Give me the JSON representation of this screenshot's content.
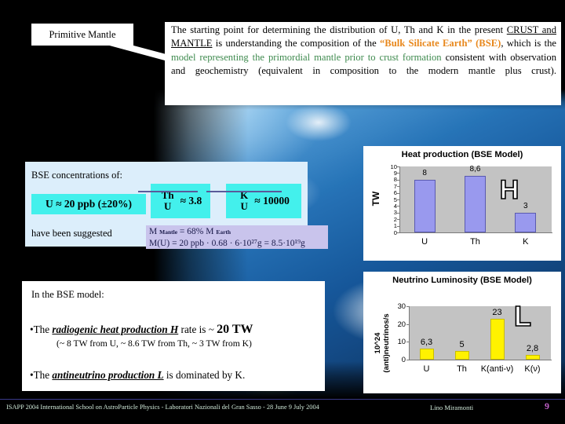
{
  "slide": {
    "background": "earth-from-space-photo",
    "page_number": "9"
  },
  "callout": {
    "label": "Primitive Mantle"
  },
  "top_box": {
    "seg1": "The starting point for determining the distribution of U, Th and K in the present ",
    "seg2_underlined": "CRUST and MANTLE",
    "seg3": " is understanding the composition of the ",
    "seg4_bse": "“Bulk Silicate Earth” (BSE)",
    "seg5": ", which is the ",
    "seg6_green": "model representing the primordial mantle prior to crust formation",
    "seg7": " consistent with observation and geochemistry (equivalent in composition to the modern mantle plus crust)."
  },
  "concentrations": {
    "title": "BSE concentrations of:",
    "u_value": "U ≈ 20 ppb (±20%)",
    "suggested": "have been suggested",
    "ratios": [
      {
        "num": "Th",
        "den": "U",
        "value": "≈ 3.8"
      },
      {
        "num": "K",
        "den": "U",
        "value": "≈ 10000"
      }
    ]
  },
  "mass_box": {
    "line1_pre": "M ",
    "line1_sub": "Mantle",
    "line1_post": " = 68% M ",
    "line1_sub2": "Earth",
    "line2": "M(U) = 20 ppb · 0.68 · 6·10²⁷g = 8.5·10¹⁹g"
  },
  "bottom_box": {
    "intro": "In the BSE model:",
    "bullet1_pre": "•The ",
    "bullet1_em": "radiogenic heat production H",
    "bullet1_mid": " rate is ~ ",
    "bullet1_big": "20 TW",
    "bullet1_sub": "(~ 8 TW from U, ~ 8.6 TW from Th, ~ 3 TW from K)",
    "bullet2_pre": "•The ",
    "bullet2_em": "antineutrino production L",
    "bullet2_post": " is dominated by K."
  },
  "charts": [
    {
      "id": "heat-production-chart",
      "overlay_letter": "H"
    },
    {
      "id": "neutrino-luminosity-chart",
      "overlay_letter": "L"
    }
  ],
  "chart_data": [
    {
      "type": "bar",
      "id": "heat-production-chart",
      "title": "Heat production (BSE Model)",
      "xlabel": "",
      "ylabel": "TW",
      "categories": [
        "U",
        "Th",
        "K"
      ],
      "values": [
        8,
        8.6,
        3
      ],
      "value_labels": [
        "8",
        "8,6",
        "3"
      ],
      "ylim": [
        0,
        10
      ],
      "yticks": [
        0,
        1,
        2,
        3,
        4,
        5,
        6,
        7,
        8,
        9,
        10
      ],
      "ytick_labels": [
        "0",
        "1",
        "2",
        "3",
        "4",
        "5",
        "6",
        "7",
        "8",
        "9",
        "10"
      ],
      "grid": false,
      "legend": "none",
      "bar_color": "#9999EE",
      "plot_bg": "#C3C3C3",
      "annotation": "H"
    },
    {
      "type": "bar",
      "id": "neutrino-luminosity-chart",
      "title": "Neutrino Luminosity (BSE Model)",
      "xlabel": "",
      "ylabel": "10^24 (anti)neutrinos/s",
      "categories": [
        "U",
        "Th",
        "K(anti-ν)",
        "K(ν)"
      ],
      "values": [
        6.3,
        5,
        23,
        2.8
      ],
      "value_labels": [
        "6,3",
        "5",
        "23",
        "2,8"
      ],
      "ylim": [
        0,
        30
      ],
      "yticks": [
        0,
        10,
        20,
        30
      ],
      "ytick_labels": [
        "0",
        "10",
        "20",
        "30"
      ],
      "grid": false,
      "legend": "none",
      "bar_color": "#FFF200",
      "plot_bg": "#C3C3C3",
      "annotation": "L"
    }
  ],
  "footer": {
    "left": "ISAPP 2004 International School on AstroParticle Physics - Laboratori Nazionali del Gran Sasso - 28 June 9 July 2004",
    "author": "Lino Miramonti",
    "page": "9"
  }
}
